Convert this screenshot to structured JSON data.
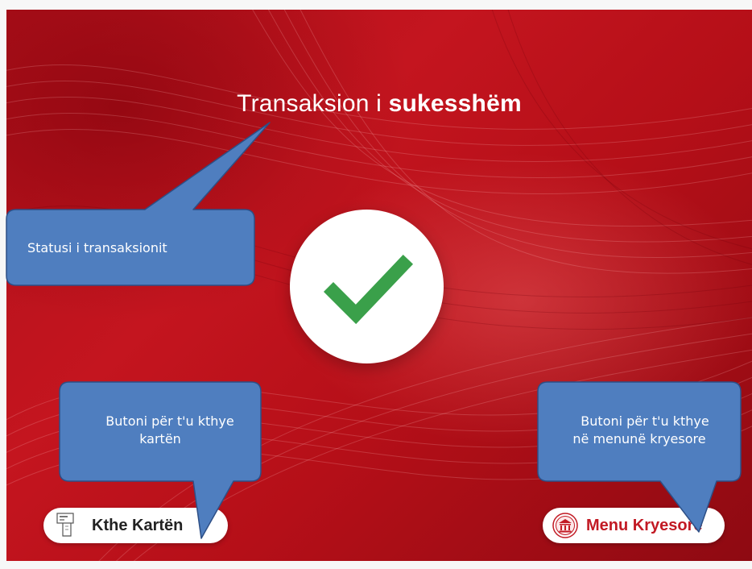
{
  "screen": {
    "title_prefix": "Transaksion i",
    "title_emphasis": "sukesshëm",
    "status_icon": "checkmark-icon",
    "colors": {
      "background": "#c4151f",
      "check": "#3aa04a",
      "menu_text": "#c21a24",
      "callout_fill": "#4f7ebf",
      "callout_border": "#2d4f86"
    }
  },
  "buttons": {
    "return_card": {
      "label": "Kthe Kartën",
      "icon": "card-slot-icon"
    },
    "main_menu": {
      "label": "Menu Kryesore",
      "icon": "bank-icon"
    }
  },
  "callouts": {
    "status": "Statusi i transaksionit",
    "return_card_line1": "Butoni për t'u kthye",
    "return_card_line2": "kartën",
    "main_menu_line1": "Butoni për t'u kthye",
    "main_menu_line2": "në menunë kryesore"
  }
}
